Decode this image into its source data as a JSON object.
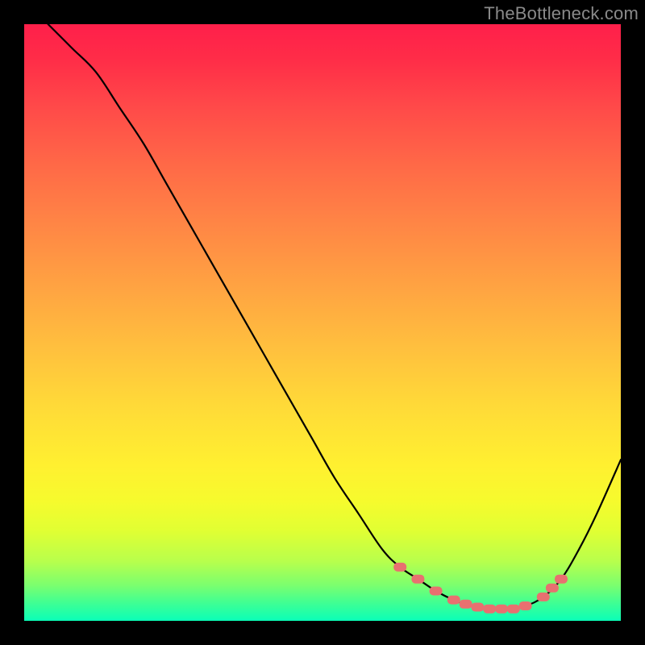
{
  "watermark": "TheBottleneck.com",
  "chart_data": {
    "type": "line",
    "title": "",
    "xlabel": "",
    "ylabel": "",
    "xlim": [
      0,
      100
    ],
    "ylim": [
      0,
      100
    ],
    "grid": false,
    "series": [
      {
        "name": "curve",
        "x": [
          4,
          8,
          12,
          16,
          20,
          24,
          28,
          32,
          36,
          40,
          44,
          48,
          52,
          56,
          60,
          63,
          66,
          69,
          72,
          75,
          78,
          81,
          84,
          87,
          90,
          93,
          96,
          100
        ],
        "values": [
          100,
          96,
          92,
          86,
          80,
          73,
          66,
          59,
          52,
          45,
          38,
          31,
          24,
          18,
          12,
          9,
          7,
          5,
          3.5,
          2.5,
          2,
          2,
          2.5,
          4,
          7,
          12,
          18,
          27
        ],
        "color": "#000000"
      }
    ],
    "markers": {
      "name": "highlight-dots",
      "x": [
        63,
        66,
        69,
        72,
        74,
        76,
        78,
        80,
        82,
        84,
        87,
        88.5,
        90
      ],
      "values": [
        9,
        7,
        5,
        3.5,
        2.8,
        2.3,
        2,
        2,
        2,
        2.5,
        4,
        5.5,
        7
      ],
      "color": "#e87070",
      "shape": "rounded-rect"
    },
    "background": {
      "type": "vertical-gradient",
      "stops": [
        {
          "pos": 0.0,
          "color": "#ff1f4a"
        },
        {
          "pos": 0.25,
          "color": "#ff6a47"
        },
        {
          "pos": 0.5,
          "color": "#ffbf3e"
        },
        {
          "pos": 0.75,
          "color": "#fff030"
        },
        {
          "pos": 0.9,
          "color": "#b8ff4c"
        },
        {
          "pos": 1.0,
          "color": "#0affb8"
        }
      ]
    }
  }
}
